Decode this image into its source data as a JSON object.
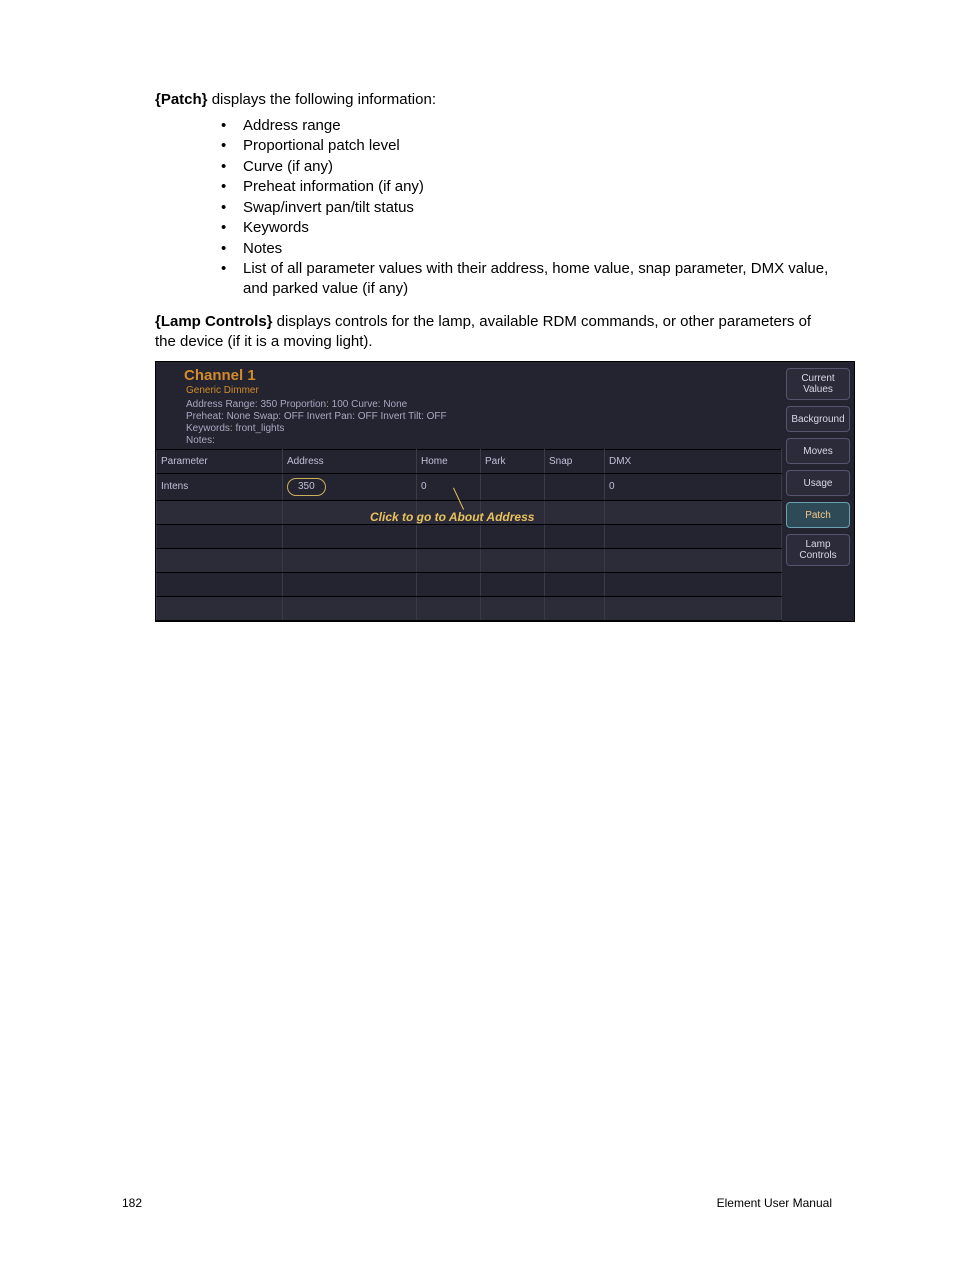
{
  "intro": {
    "patch_label": "{Patch}",
    "patch_rest": " displays the following information:",
    "bullets": [
      "Address range",
      "Proportional patch level",
      "Curve (if any)",
      "Preheat information (if any)",
      "Swap/invert pan/tilt status",
      "Keywords",
      "Notes",
      "List of all parameter values with their address, home value, snap parameter, DMX value, and parked value (if any)"
    ],
    "lamp_label": "{Lamp Controls}",
    "lamp_rest": " displays controls for the lamp, available RDM commands, or other parameters of the device (if it is a moving light)."
  },
  "ui": {
    "channel_title": "Channel 1",
    "channel_sub": "Generic Dimmer",
    "meta_line1": "Address Range: 350   Proportion: 100   Curve: None",
    "meta_line2": "Preheat: None   Swap: OFF   Invert Pan: OFF   Invert Tilt: OFF",
    "meta_line3": "Keywords: front_lights",
    "meta_line4": "Notes:",
    "columns": {
      "parameter": "Parameter",
      "address": "Address",
      "home": "Home",
      "park": "Park",
      "snap": "Snap",
      "dmx": "DMX"
    },
    "row": {
      "parameter": "Intens",
      "address": "350",
      "home": "0",
      "park": "",
      "snap": "",
      "dmx": "0"
    },
    "callout": "Click to go to About Address",
    "side": {
      "current_values": "Current Values",
      "background": "Background",
      "moves": "Moves",
      "usage": "Usage",
      "patch": "Patch",
      "lamp_controls": "Lamp Controls"
    }
  },
  "footer": {
    "page": "182",
    "manual": "Element User Manual"
  }
}
